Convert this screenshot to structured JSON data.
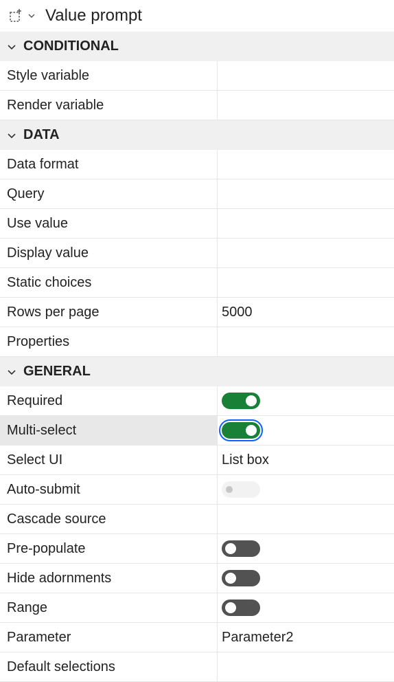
{
  "header": {
    "title": "Value prompt",
    "icon": "select-dashed-icon"
  },
  "sections": {
    "conditional": {
      "label": "CONDITIONAL",
      "rows": [
        {
          "label": "Style variable",
          "value": ""
        },
        {
          "label": "Render variable",
          "value": ""
        }
      ]
    },
    "data": {
      "label": "DATA",
      "rows": [
        {
          "label": "Data format",
          "value": ""
        },
        {
          "label": "Query",
          "value": ""
        },
        {
          "label": "Use value",
          "value": ""
        },
        {
          "label": "Display value",
          "value": ""
        },
        {
          "label": "Static choices",
          "value": ""
        },
        {
          "label": "Rows per page",
          "value": "5000"
        },
        {
          "label": "Properties",
          "value": ""
        }
      ]
    },
    "general": {
      "label": "GENERAL",
      "rows": [
        {
          "label": "Required",
          "toggle": "on"
        },
        {
          "label": "Multi-select",
          "toggle": "on"
        },
        {
          "label": "Select UI",
          "value": "List box"
        },
        {
          "label": "Auto-submit",
          "toggle": "disabled"
        },
        {
          "label": "Cascade source",
          "value": ""
        },
        {
          "label": "Pre-populate",
          "toggle": "off"
        },
        {
          "label": "Hide adornments",
          "toggle": "off"
        },
        {
          "label": "Range",
          "toggle": "off"
        },
        {
          "label": "Parameter",
          "value": "Parameter2"
        },
        {
          "label": "Default selections",
          "value": ""
        }
      ]
    }
  },
  "colors": {
    "toggle_on": "#198038",
    "toggle_off": "#525252",
    "focus_ring": "#0f62fe",
    "section_bg": "#f0f0f0"
  }
}
